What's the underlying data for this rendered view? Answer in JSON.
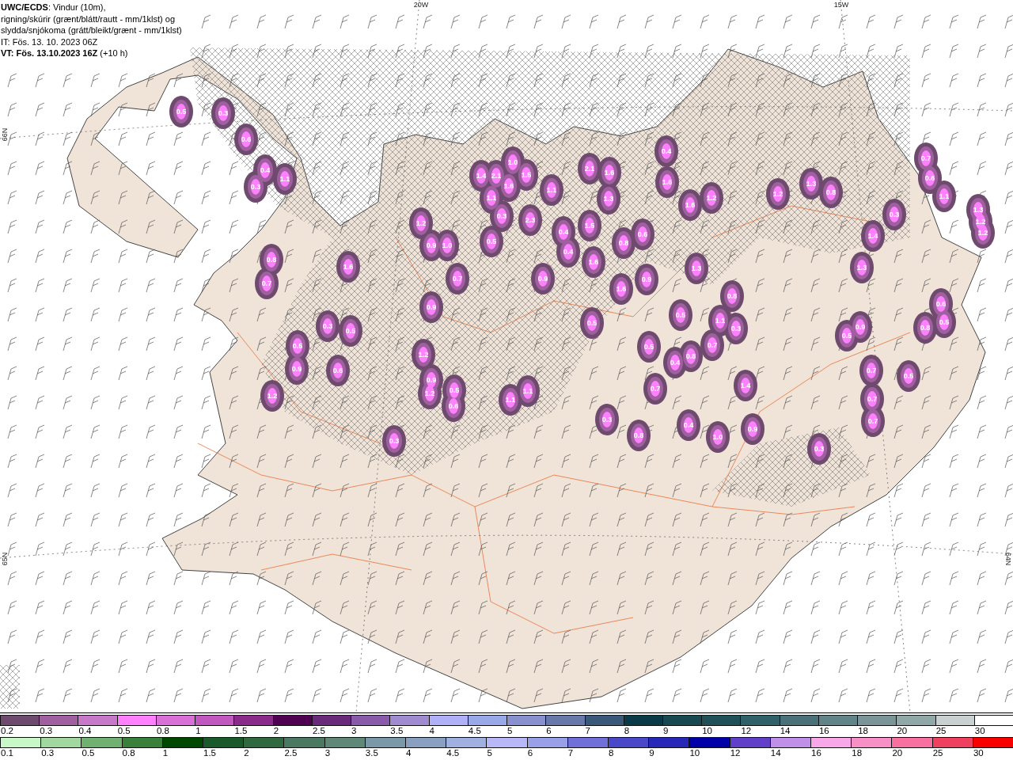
{
  "header": {
    "title_lines": [
      "**UWC/ECDS**: Vindur (10m),",
      "rigning/skúrir (grænt/blátt/rautt - mm/1klst) og",
      "slydda/snjókoma (grátt/bleikt/grænt - mm/1klst)"
    ],
    "initial_time": "IT: Fös. 13. 10. 2023 06Z",
    "valid_time": "**VT: Fös. 13.10.2023 16Z** (+10 h)"
  },
  "map": {
    "grid_labels": [
      "20W",
      "15W",
      "66N",
      "65N",
      "64N"
    ],
    "value_labels": [
      "0.5",
      "0.3",
      "0.6",
      "0.4",
      "0.3",
      "1.1",
      "0.8",
      "0.7",
      "1.6",
      "0.3",
      "0.5",
      "0.5",
      "0.9",
      "0.6",
      "1.2",
      "1.2",
      "0.9",
      "1.0",
      "0.7",
      "0.9",
      "1.2",
      "0.9",
      "1.2",
      "0.5",
      "0.6",
      "0.3",
      "1.4",
      "2.1",
      "1.0",
      "1.5",
      "1.6",
      "1.1",
      "0.3",
      "2.3",
      "1.1",
      "0.5",
      "0.9",
      "0.4",
      "0.4",
      "1.1",
      "1.1",
      "2.1",
      "1.6",
      "1.3",
      "1.5",
      "0.8",
      "1.6",
      "1.6",
      "0.6",
      "0.9",
      "0.5",
      "0.5",
      "0.4",
      "1.6",
      "1.6",
      "1.2",
      "1.3",
      "0.8",
      "1.1",
      "0.3",
      "0.5",
      "0.4",
      "0.8",
      "0.7",
      "0.7",
      "0.4",
      "1.0",
      "1.4",
      "0.9",
      "0.3",
      "0.8",
      "1.2",
      "1.3",
      "0.8",
      "1.4",
      "1.3",
      "0.3",
      "0.5",
      "0.9",
      "0.7",
      "0.7",
      "0.7",
      "0.5",
      "0.8",
      "0.6",
      "0.5",
      "0.3",
      "0.7",
      "0.6",
      "1.3",
      "1.2",
      "1.2",
      "1.1"
    ]
  },
  "legend": {
    "scales": [
      {
        "items": [
          {
            "label": "0.2",
            "color": "#6e4a6e"
          },
          {
            "label": "0.3",
            "color": "#a060a0"
          },
          {
            "label": "0.4",
            "color": "#c878c8"
          },
          {
            "label": "0.5",
            "color": "#ff80ff"
          },
          {
            "label": "0.8",
            "color": "#d870d8"
          },
          {
            "label": "1",
            "color": "#c058c0"
          },
          {
            "label": "1.5",
            "color": "#8a2a8a"
          },
          {
            "label": "2",
            "color": "#500050"
          },
          {
            "label": "2.5",
            "color": "#6a2a7a"
          },
          {
            "label": "3",
            "color": "#8a5aaa"
          },
          {
            "label": "3.5",
            "color": "#a08ad0"
          },
          {
            "label": "4",
            "color": "#b0b0f8"
          },
          {
            "label": "4.5",
            "color": "#98a8e8"
          },
          {
            "label": "5",
            "color": "#8890d0"
          },
          {
            "label": "6",
            "color": "#6878a8"
          },
          {
            "label": "7",
            "color": "#3a5878"
          },
          {
            "label": "8",
            "color": "#0a3a48"
          },
          {
            "label": "9",
            "color": "#184850"
          },
          {
            "label": "10",
            "color": "#205058"
          },
          {
            "label": "12",
            "color": "#306068"
          },
          {
            "label": "14",
            "color": "#4a7078"
          },
          {
            "label": "16",
            "color": "#608488"
          },
          {
            "label": "18",
            "color": "#7a9498"
          },
          {
            "label": "20",
            "color": "#90a8a8"
          },
          {
            "label": "25",
            "color": "#c8d0d0"
          },
          {
            "label": "30",
            "color": "#ffffff"
          }
        ]
      },
      {
        "items": [
          {
            "label": "0.1",
            "color": "#c8f8c8"
          },
          {
            "label": "0.3",
            "color": "#a0d8a0"
          },
          {
            "label": "0.5",
            "color": "#70b070"
          },
          {
            "label": "0.8",
            "color": "#3a803a"
          },
          {
            "label": "1",
            "color": "#004800"
          },
          {
            "label": "1.5",
            "color": "#1a5a2a"
          },
          {
            "label": "2",
            "color": "#306840"
          },
          {
            "label": "2.5",
            "color": "#4a7860"
          },
          {
            "label": "3",
            "color": "#608878"
          },
          {
            "label": "3.5",
            "color": "#7a98a8"
          },
          {
            "label": "4",
            "color": "#8aa0c0"
          },
          {
            "label": "4.5",
            "color": "#a0b0e0"
          },
          {
            "label": "5",
            "color": "#b8b8f8"
          },
          {
            "label": "6",
            "color": "#98a0e8"
          },
          {
            "label": "7",
            "color": "#7070d8"
          },
          {
            "label": "8",
            "color": "#4848c8"
          },
          {
            "label": "9",
            "color": "#2828b8"
          },
          {
            "label": "10",
            "color": "#0000a8"
          },
          {
            "label": "12",
            "color": "#6040c8"
          },
          {
            "label": "14",
            "color": "#c090e8"
          },
          {
            "label": "16",
            "color": "#f8a8e8"
          },
          {
            "label": "18",
            "color": "#f890c8"
          },
          {
            "label": "20",
            "color": "#f870a0"
          },
          {
            "label": "25",
            "color": "#f04060"
          },
          {
            "label": "30",
            "color": "#f80000"
          }
        ]
      }
    ]
  }
}
